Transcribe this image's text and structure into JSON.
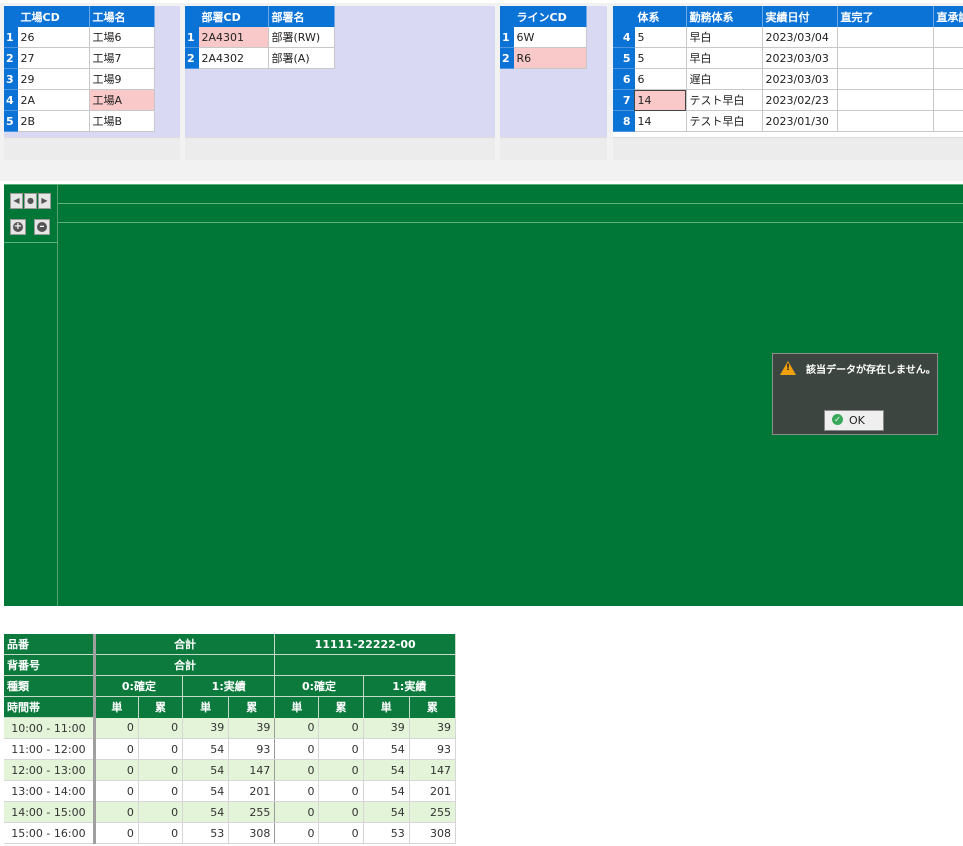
{
  "factory_grid": {
    "headers": [
      "工場CD",
      "工場名"
    ],
    "rows": [
      {
        "no": "1",
        "cd": "26",
        "name": "工場6"
      },
      {
        "no": "2",
        "cd": "27",
        "name": "工場7"
      },
      {
        "no": "3",
        "cd": "29",
        "name": "工場9"
      },
      {
        "no": "4",
        "cd": "2A",
        "name": "工場A"
      },
      {
        "no": "5",
        "cd": "2B",
        "name": "工場B"
      }
    ]
  },
  "dept_grid": {
    "headers": [
      "部署CD",
      "部署名"
    ],
    "rows": [
      {
        "no": "1",
        "cd": "2A4301",
        "name": "部署(RW)"
      },
      {
        "no": "2",
        "cd": "2A4302",
        "name": "部署(A)"
      }
    ]
  },
  "line_grid": {
    "headers": [
      "ラインCD"
    ],
    "rows": [
      {
        "no": "1",
        "cd": "6W"
      },
      {
        "no": "2",
        "cd": "R6"
      }
    ]
  },
  "shift_grid": {
    "headers": [
      "体系",
      "勤務体系",
      "実績日付",
      "直完了",
      "直承認"
    ],
    "rows": [
      {
        "no": "4",
        "code": "5",
        "shift": "早白",
        "date": "2023/03/04",
        "done": "",
        "approve": ""
      },
      {
        "no": "5",
        "code": "5",
        "shift": "早白",
        "date": "2023/03/03",
        "done": "",
        "approve": ""
      },
      {
        "no": "6",
        "code": "6",
        "shift": "遅白",
        "date": "2023/03/03",
        "done": "",
        "approve": ""
      },
      {
        "no": "7",
        "code": "14",
        "shift": "テスト早白",
        "date": "2023/02/23",
        "done": "",
        "approve": ""
      },
      {
        "no": "8",
        "code": "14",
        "shift": "テスト早白",
        "date": "2023/01/30",
        "done": "",
        "approve": ""
      }
    ]
  },
  "chart_nav": {
    "left_icon": "arrow-left-icon",
    "center_icon": "dot-icon",
    "right_icon": "arrow-right-icon",
    "zoom_in_icon": "plus-icon",
    "zoom_out_icon": "minus-icon"
  },
  "dialog": {
    "message": "該当データが存在しません。",
    "ok_label": "OK",
    "icon": "warning-icon"
  },
  "summary": {
    "row_labels": [
      "品番",
      "背番号",
      "種類",
      "時間帯"
    ],
    "group_total": "合計",
    "group_part": "11111-22222-00",
    "back_total": "合計",
    "back_part": "",
    "kinds": [
      "0:確定",
      "1:実績",
      "0:確定",
      "1:実績"
    ],
    "sub": [
      "単",
      "累",
      "単",
      "累",
      "単",
      "累",
      "単",
      "累"
    ],
    "rows": [
      {
        "time": "10:00 - 11:00",
        "v": [
          "0",
          "0",
          "39",
          "39",
          "0",
          "0",
          "39",
          "39"
        ]
      },
      {
        "time": "11:00 - 12:00",
        "v": [
          "0",
          "0",
          "54",
          "93",
          "0",
          "0",
          "54",
          "93"
        ]
      },
      {
        "time": "12:00 - 13:00",
        "v": [
          "0",
          "0",
          "54",
          "147",
          "0",
          "0",
          "54",
          "147"
        ]
      },
      {
        "time": "13:00 - 14:00",
        "v": [
          "0",
          "0",
          "54",
          "201",
          "0",
          "0",
          "54",
          "201"
        ]
      },
      {
        "time": "14:00 - 15:00",
        "v": [
          "0",
          "0",
          "54",
          "255",
          "0",
          "0",
          "54",
          "255"
        ]
      },
      {
        "time": "15:00 - 16:00",
        "v": [
          "0",
          "0",
          "53",
          "308",
          "0",
          "0",
          "53",
          "308"
        ]
      }
    ]
  },
  "colors": {
    "grid_header": "#0b72d6",
    "selected_cell": "#f9c9c9",
    "chart_bg": "#007637",
    "summary_header": "#0b7a3c",
    "summary_alt_row": "#e4f4d8"
  }
}
